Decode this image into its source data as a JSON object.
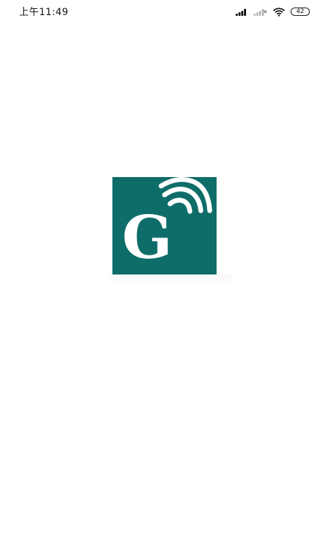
{
  "status_bar": {
    "time": "上午11:49",
    "battery_level": "42",
    "icons": [
      "signal-icon",
      "signal-no-service-icon",
      "wifi-icon",
      "battery-icon"
    ]
  },
  "splash": {
    "logo": {
      "letter": "G",
      "icon": "wireless-signal-icon",
      "background_color": "#0f6d69",
      "foreground_color": "#ffffff"
    }
  },
  "colors": {
    "background": "#ffffff",
    "text": "#111111"
  }
}
